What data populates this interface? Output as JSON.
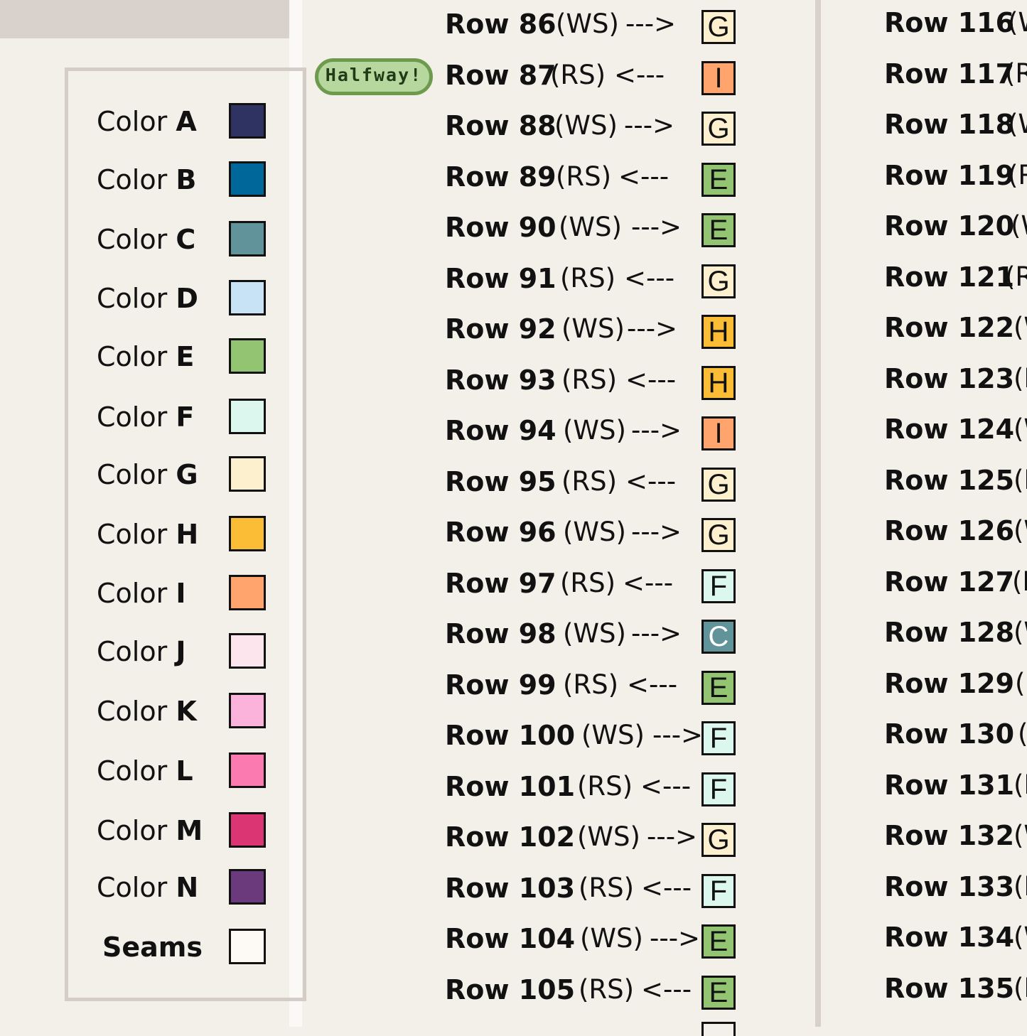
{
  "legend": {
    "prefix": "Color",
    "colors": [
      {
        "letter": "A",
        "hex": "#2e3361"
      },
      {
        "letter": "B",
        "hex": "#00679b"
      },
      {
        "letter": "C",
        "hex": "#61939a"
      },
      {
        "letter": "D",
        "hex": "#c7e3f5"
      },
      {
        "letter": "E",
        "hex": "#93c472"
      },
      {
        "letter": "F",
        "hex": "#dbf7ee"
      },
      {
        "letter": "G",
        "hex": "#fdf0cf"
      },
      {
        "letter": "H",
        "hex": "#fbbd36"
      },
      {
        "letter": "I",
        "hex": "#fea46c"
      },
      {
        "letter": "J",
        "hex": "#fde5ee"
      },
      {
        "letter": "K",
        "hex": "#fcb3db"
      },
      {
        "letter": "L",
        "hex": "#fb7bb0"
      },
      {
        "letter": "M",
        "hex": "#dc3573"
      },
      {
        "letter": "N",
        "hex": "#6a3a7d"
      }
    ],
    "seams": {
      "label": "Seams",
      "hex": "#fdf9f4"
    }
  },
  "badge": {
    "label": "Halfway!"
  },
  "middle_rows": [
    {
      "label": "Row 86",
      "side": "(WS)",
      "arrow": "--->",
      "color": "G"
    },
    {
      "label": "Row 87",
      "side": "(RS)",
      "arrow": "<---",
      "color": "I"
    },
    {
      "label": "Row 88",
      "side": "(WS)",
      "arrow": "--->",
      "color": "G"
    },
    {
      "label": "Row 89",
      "side": "(RS)",
      "arrow": "<---",
      "color": "E"
    },
    {
      "label": "Row 90",
      "side": "(WS)",
      "arrow": "--->",
      "color": "E"
    },
    {
      "label": "Row 91",
      "side": "(RS)",
      "arrow": "<---",
      "color": "G"
    },
    {
      "label": "Row 92",
      "side": "(WS)",
      "arrow": "--->",
      "color": "H"
    },
    {
      "label": "Row 93",
      "side": "(RS)",
      "arrow": "<---",
      "color": "H"
    },
    {
      "label": "Row 94",
      "side": "(WS)",
      "arrow": "--->",
      "color": "I"
    },
    {
      "label": "Row 95",
      "side": "(RS)",
      "arrow": "<---",
      "color": "G"
    },
    {
      "label": "Row 96",
      "side": "(WS)",
      "arrow": "--->",
      "color": "G"
    },
    {
      "label": "Row 97",
      "side": "(RS)",
      "arrow": "<---",
      "color": "F"
    },
    {
      "label": "Row 98",
      "side": "(WS)",
      "arrow": "--->",
      "color": "C"
    },
    {
      "label": "Row 99",
      "side": "(RS)",
      "arrow": "<---",
      "color": "E"
    },
    {
      "label": "Row 100",
      "side": "(WS)",
      "arrow": "--->",
      "color": "F"
    },
    {
      "label": "Row 101",
      "side": "(RS)",
      "arrow": "<---",
      "color": "F"
    },
    {
      "label": "Row 102",
      "side": "(WS)",
      "arrow": "--->",
      "color": "G"
    },
    {
      "label": "Row 103",
      "side": "(RS)",
      "arrow": "<---",
      "color": "F"
    },
    {
      "label": "Row 104",
      "side": "(WS)",
      "arrow": "--->",
      "color": "E"
    },
    {
      "label": "Row 105",
      "side": "(RS)",
      "arrow": "<---",
      "color": "E"
    }
  ],
  "right_rows": [
    {
      "label": "Row 116",
      "side": "(W"
    },
    {
      "label": "Row 117",
      "side": "(R"
    },
    {
      "label": "Row 118",
      "side": "(W"
    },
    {
      "label": "Row 119",
      "side": "(R"
    },
    {
      "label": "Row 120",
      "side": "(W"
    },
    {
      "label": "Row 121",
      "side": "(R"
    },
    {
      "label": "Row 122",
      "side": "(W"
    },
    {
      "label": "Row 123",
      "side": "(R"
    },
    {
      "label": "Row 124",
      "side": "(W"
    },
    {
      "label": "Row 125",
      "side": "(R"
    },
    {
      "label": "Row 126",
      "side": "(W"
    },
    {
      "label": "Row 127",
      "side": "(R"
    },
    {
      "label": "Row 128",
      "side": "(W"
    },
    {
      "label": "Row 129",
      "side": "("
    },
    {
      "label": "Row 130",
      "side": "("
    },
    {
      "label": "Row 131",
      "side": "(R"
    },
    {
      "label": "Row 132",
      "side": "(W"
    },
    {
      "label": "Row 133",
      "side": "(R"
    },
    {
      "label": "Row 134",
      "side": "(W"
    },
    {
      "label": "Row 135",
      "side": "(R"
    }
  ]
}
